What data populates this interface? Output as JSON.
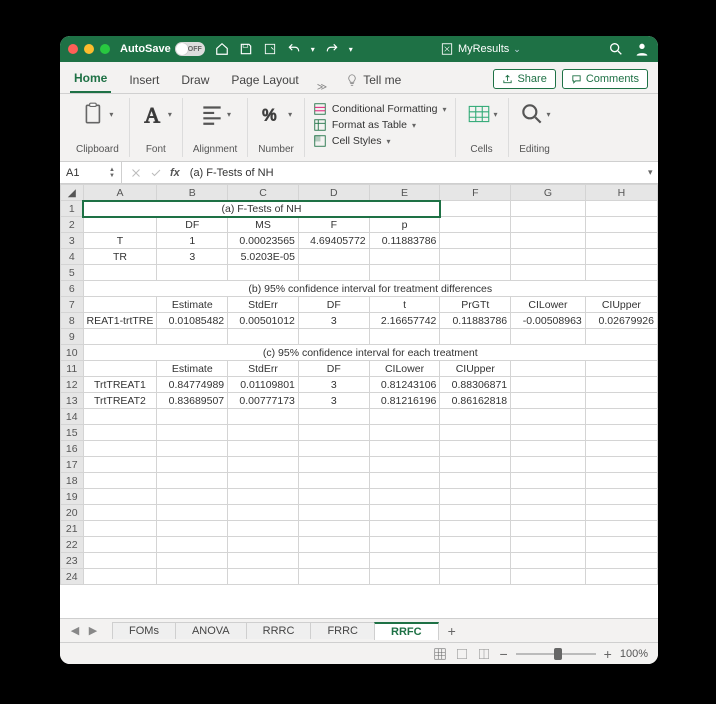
{
  "titlebar": {
    "autosave": "AutoSave",
    "autosave_state": "OFF",
    "doc_name": "MyResults"
  },
  "tabs": {
    "home": "Home",
    "insert": "Insert",
    "draw": "Draw",
    "page_layout": "Page Layout",
    "tell_me": "Tell me",
    "share": "Share",
    "comments": "Comments"
  },
  "ribbon": {
    "clipboard": "Clipboard",
    "font": "Font",
    "alignment": "Alignment",
    "number": "Number",
    "cf": "Conditional Formatting",
    "fat": "Format as Table",
    "cs": "Cell Styles",
    "cells": "Cells",
    "editing": "Editing"
  },
  "fx": {
    "cell": "A1",
    "label": "fx",
    "value": "(a) F-Tests of NH"
  },
  "cols": [
    "A",
    "B",
    "C",
    "D",
    "E",
    "F",
    "G",
    "H"
  ],
  "rows": {
    "r1": {
      "a_e": "(a) F-Tests of NH"
    },
    "r2": {
      "b": "DF",
      "c": "MS",
      "d": "F",
      "e": "p"
    },
    "r3": {
      "a": "T",
      "b": "1",
      "c": "0.00023565",
      "d": "4.69405772",
      "e": "0.11883786"
    },
    "r4": {
      "a": "TR",
      "b": "3",
      "c": "5.0203E-05"
    },
    "r6": {
      "a_h": "(b) 95% confidence interval for treatment differences"
    },
    "r7": {
      "b": "Estimate",
      "c": "StdErr",
      "d": "DF",
      "e": "t",
      "f": "PrGTt",
      "g": "CILower",
      "h": "CIUpper"
    },
    "r8": {
      "a": "REAT1-trtTRE",
      "b": "0.01085482",
      "c": "0.00501012",
      "d": "3",
      "e": "2.16657742",
      "f": "0.11883786",
      "g": "-0.00508963",
      "h": "0.02679926"
    },
    "r10": {
      "a_h": "(c) 95% confidence interval for each treatment"
    },
    "r11": {
      "b": "Estimate",
      "c": "StdErr",
      "d": "DF",
      "e": "CILower",
      "f": "CIUpper"
    },
    "r12": {
      "a": "TrtTREAT1",
      "b": "0.84774989",
      "c": "0.01109801",
      "d": "3",
      "e": "0.81243106",
      "f": "0.88306871"
    },
    "r13": {
      "a": "TrtTREAT2",
      "b": "0.83689507",
      "c": "0.00777173",
      "d": "3",
      "e": "0.81216196",
      "f": "0.86162818"
    }
  },
  "sheets": {
    "s1": "FOMs",
    "s2": "ANOVA",
    "s3": "RRRC",
    "s4": "FRRC",
    "s5": "RRFC"
  },
  "status": {
    "zoom": "100%"
  }
}
